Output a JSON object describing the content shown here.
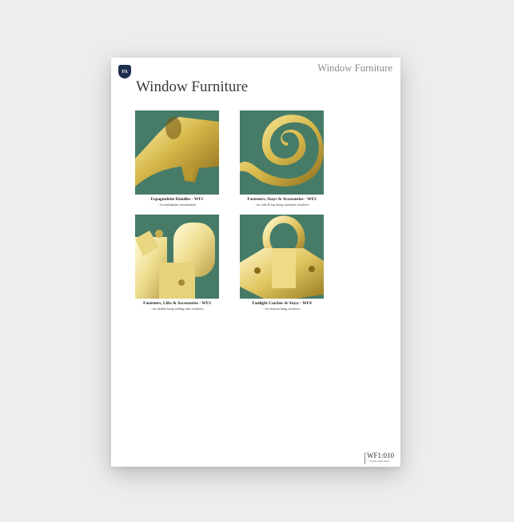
{
  "document": {
    "logo_text": "FA",
    "header_title": "Window Furniture",
    "page_title": "Window Furniture",
    "background_green": "#467b68",
    "brass_color": "#d8c25a"
  },
  "products": [
    {
      "title": "Espagnolette Handles - WF1",
      "subtitle": "- for multipoint mechanisms",
      "image": "espagnolette-handle"
    },
    {
      "title": "Fasteners, Stays & Accessories - WF2",
      "subtitle": "- for side & top hung casement windows",
      "image": "scroll-stay"
    },
    {
      "title": "Fasteners, Lifts & Accessories - WF3",
      "subtitle": "- for double hung sliding sash windows",
      "image": "sash-fastener"
    },
    {
      "title": "Fanlight Catches & Stays - WF4",
      "subtitle": "- for bottom hung windows",
      "image": "fanlight-catch"
    }
  ],
  "footer": {
    "code": "WF1:010",
    "copyright": "© Frank Allart 2021"
  }
}
